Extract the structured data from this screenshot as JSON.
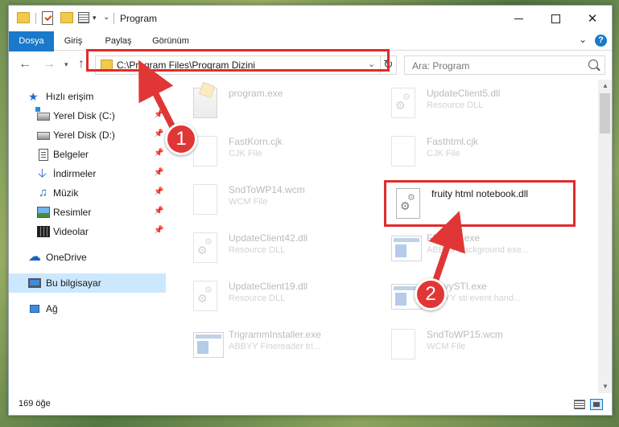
{
  "window": {
    "title": "Program"
  },
  "ribbon": {
    "tabs": [
      "Dosya",
      "Giriş",
      "Paylaş",
      "Görünüm"
    ]
  },
  "address": {
    "path": "C:\\Program Files\\Program Dizini"
  },
  "search": {
    "placeholder": "Ara: Program"
  },
  "sidebar": {
    "items": [
      {
        "label": "Hızlı erişim",
        "icon": "star-icon"
      },
      {
        "label": "Yerel Disk (C:)",
        "icon": "drive-icon",
        "pinned": true
      },
      {
        "label": "Yerel Disk (D:)",
        "icon": "drive-icon",
        "pinned": true
      },
      {
        "label": "Belgeler",
        "icon": "documents-icon",
        "pinned": true
      },
      {
        "label": "İndirmeler",
        "icon": "download-icon",
        "pinned": true
      },
      {
        "label": "Müzik",
        "icon": "music-icon",
        "pinned": true
      },
      {
        "label": "Resimler",
        "icon": "pictures-icon",
        "pinned": true
      },
      {
        "label": "Videolar",
        "icon": "videos-icon",
        "pinned": true
      },
      {
        "label": "OneDrive",
        "icon": "onedrive-icon"
      },
      {
        "label": "Bu bilgisayar",
        "icon": "computer-icon",
        "selected": true
      },
      {
        "label": "Ağ",
        "icon": "network-icon"
      }
    ]
  },
  "files": [
    {
      "name": "program.exe",
      "type": "",
      "icon": "setup-exe-icon"
    },
    {
      "name": "UpdateClient5.dll",
      "type": "Resource DLL",
      "icon": "dll-gear-icon"
    },
    {
      "name": "FastKorn.cjk",
      "type": "CJK File",
      "icon": "blank-file-icon"
    },
    {
      "name": "Fasthtml.cjk",
      "type": "CJK File",
      "icon": "blank-file-icon"
    },
    {
      "name": "SndToWP14.wcm",
      "type": "WCM File",
      "icon": "blank-file-icon"
    },
    {
      "name": "fruity html notebook.dll",
      "type": "",
      "icon": "dll-gear-icon",
      "highlighted": true
    },
    {
      "name": "UpdateClient42.dll",
      "type": "Resource DLL",
      "icon": "dll-gear-icon"
    },
    {
      "name": "FRSpec.exe",
      "type": "ABBYY background exe...",
      "icon": "window-exe-icon"
    },
    {
      "name": "UpdateClient19.dll",
      "type": "Resource DLL",
      "icon": "dll-gear-icon"
    },
    {
      "name": "AbbyySTI.exe",
      "type": "ABBYY sti event hand...",
      "icon": "window-exe-icon"
    },
    {
      "name": "TrigrammInstaller.exe",
      "type": "ABBYY Finereader tri...",
      "icon": "window-exe-icon"
    },
    {
      "name": "SndToWP15.wcm",
      "type": "WCM File",
      "icon": "blank-file-icon"
    }
  ],
  "status": {
    "count": "169 öğe"
  },
  "annotations": {
    "step1": "1",
    "step2": "2"
  },
  "colors": {
    "accent": "#1979ca",
    "annotation": "#e02b2b",
    "selection": "#cce8ff"
  }
}
